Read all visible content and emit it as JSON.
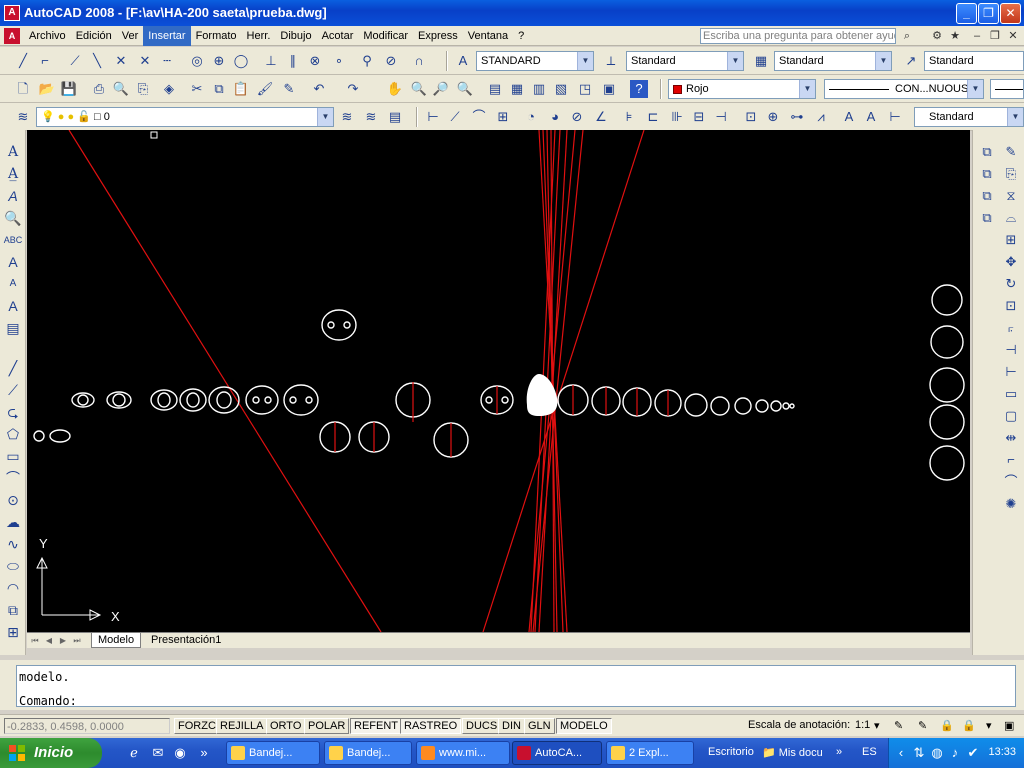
{
  "window": {
    "title": "AutoCAD 2008 - [F:\\av\\HA-200 saeta\\prueba.dwg]",
    "app_icon": "A",
    "buttons": [
      "_",
      "❐",
      "✕"
    ]
  },
  "menubar": {
    "items": [
      "Archivo",
      "Edición",
      "Ver",
      "Insertar",
      "Formato",
      "Herr.",
      "Dibujo",
      "Acotar",
      "Modificar",
      "Express",
      "Ventana",
      "?"
    ],
    "active_index": 3,
    "help_placeholder": "Escriba una pregunta para obtener ayuda"
  },
  "toolbar1": {
    "text_style": "STANDARD",
    "dim_style": "Standard",
    "table_style": "Standard",
    "mleader_style": "Standard"
  },
  "toolbar2": {
    "color": "Rojo",
    "color_hex": "#e00000",
    "linetype": "CON...NUOUS"
  },
  "toolbar3": {
    "layer": "0",
    "dim_style": "Standard"
  },
  "drawing": {
    "background": "#000000",
    "ucs_x_label": "X",
    "ucs_y_label": "Y"
  },
  "tabs": {
    "items": [
      "Modelo",
      "Presentación1"
    ],
    "active_index": 0
  },
  "command": {
    "line1": "modelo.",
    "line2": "Comando:"
  },
  "statusbar": {
    "coords": "-0.2833, 0.4598, 0.0000",
    "buttons": [
      "FORZC",
      "REJILLA",
      "ORTO",
      "POLAR",
      "REFENT",
      "RASTREO",
      "DUCS",
      "DIN",
      "GLN",
      "MODELO"
    ],
    "on": [
      "REFENT",
      "RASTREO",
      "MODELO"
    ],
    "annotation_scale_label": "Escala de anotación:",
    "annotation_scale": "1:1"
  },
  "taskbar": {
    "start_label": "Inicio",
    "tasks": [
      "Bandej...",
      "Bandej...",
      "www.mi...",
      "AutoCA...",
      "2 Expl..."
    ],
    "active_task_index": 3,
    "desktop_label": "Escritorio",
    "docs_label": "Mis docu",
    "language": "ES",
    "clock": "13:33"
  }
}
